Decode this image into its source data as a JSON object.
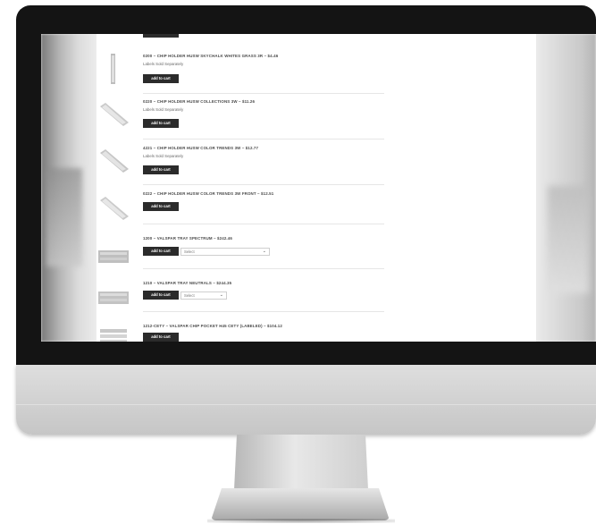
{
  "products": [
    {
      "title": "0200 – CHIP HOLDER HUSW SKYCHALK WHITES GRASS 3R – $4.46",
      "note": "Labels Sold Separately",
      "button": "add to cart"
    },
    {
      "title": "0220 – CHIP HOLDER HUSW COLLECTIONS 3W – $11.26",
      "note": "Labels Sold Separately",
      "button": "add to cart"
    },
    {
      "title": "4221 – CHIP HOLDER HUSW COLOR TRENDS 3W – $12.77",
      "note": "Labels Sold Separately",
      "button": "add to cart"
    },
    {
      "title": "0222 – CHIP HOLDER HUSW COLOR TRENDS 3W FRONT – $12.51",
      "button": "add to cart"
    },
    {
      "title": "1200 – VALSPAR TRAY SPECTRUM – $242.46",
      "button": "add to cart",
      "select_value": "Select"
    },
    {
      "title": "1210 – VALSPAR TRAY NEUTRALS – $244.35",
      "button": "add to cart",
      "select_value": "Select"
    },
    {
      "title": "1212-CETY – VALSPAR CHIP POCKET H45 CETY (LABELED) – $104.12",
      "button": "add to cart"
    }
  ]
}
